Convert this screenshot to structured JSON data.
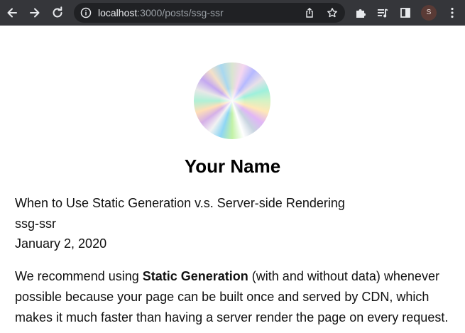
{
  "browser": {
    "url_host": "localhost",
    "url_rest": ":3000/posts/ssg-ssr",
    "profile_initial": "S",
    "icons": [
      "back-arrow-icon",
      "forward-arrow-icon",
      "reload-icon",
      "info-icon",
      "share-icon",
      "bookmark-star-icon",
      "extensions-icon",
      "reading-list-icon",
      "side-panel-icon",
      "more-options-icon"
    ]
  },
  "profile": {
    "name": "Your Name"
  },
  "post": {
    "title": "When to Use Static Generation v.s. Server-side Rendering",
    "id": "ssg-ssr",
    "date": "January 2, 2020",
    "body_before": "We recommend using ",
    "body_bold": "Static Generation",
    "body_after": " (with and without data) whenever possible because your page can be built once and served by CDN, which makes it much faster than having a server render the page on every request."
  }
}
